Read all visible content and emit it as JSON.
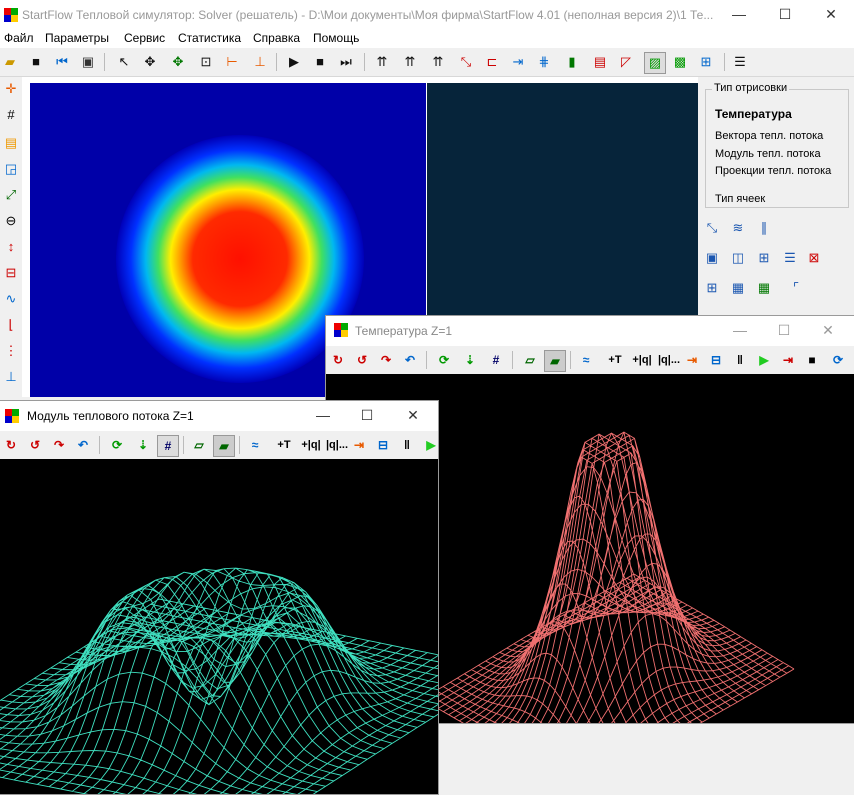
{
  "app": {
    "title": "StartFlow Тепловой симулятор: Solver (решатель) - D:\\Мои документы\\Моя фирма\\StartFlow 4.01 (неполная версия 2)\\1 Те...",
    "minimize": "—",
    "maximize": "☐",
    "close": "✕"
  },
  "menu": [
    "Файл",
    "Параметры",
    "Сервис",
    "Статистика",
    "Справка",
    "Помощь"
  ],
  "panel": {
    "group_title": "Тип отрисовки",
    "options": [
      "Температура",
      "Вектора тепл. потока",
      "Модуль тепл. потока",
      "Проекции тепл. потока"
    ],
    "cell_type_label": "Тип ячеек"
  },
  "colors": {
    "mesh_heat": "#f07070",
    "mesh_flux": "#3fe0c0",
    "field_blue": "#0000a8",
    "field_dark": "#06243a"
  },
  "windows": {
    "temperature": {
      "title": "Температура Z=1",
      "tb_text": [
        "+T",
        "+|q|",
        "|q|..."
      ]
    },
    "flux": {
      "title": "Модуль теплового потока Z=1",
      "tb_text": [
        "+T",
        "+|q|",
        "|q|..."
      ]
    }
  }
}
